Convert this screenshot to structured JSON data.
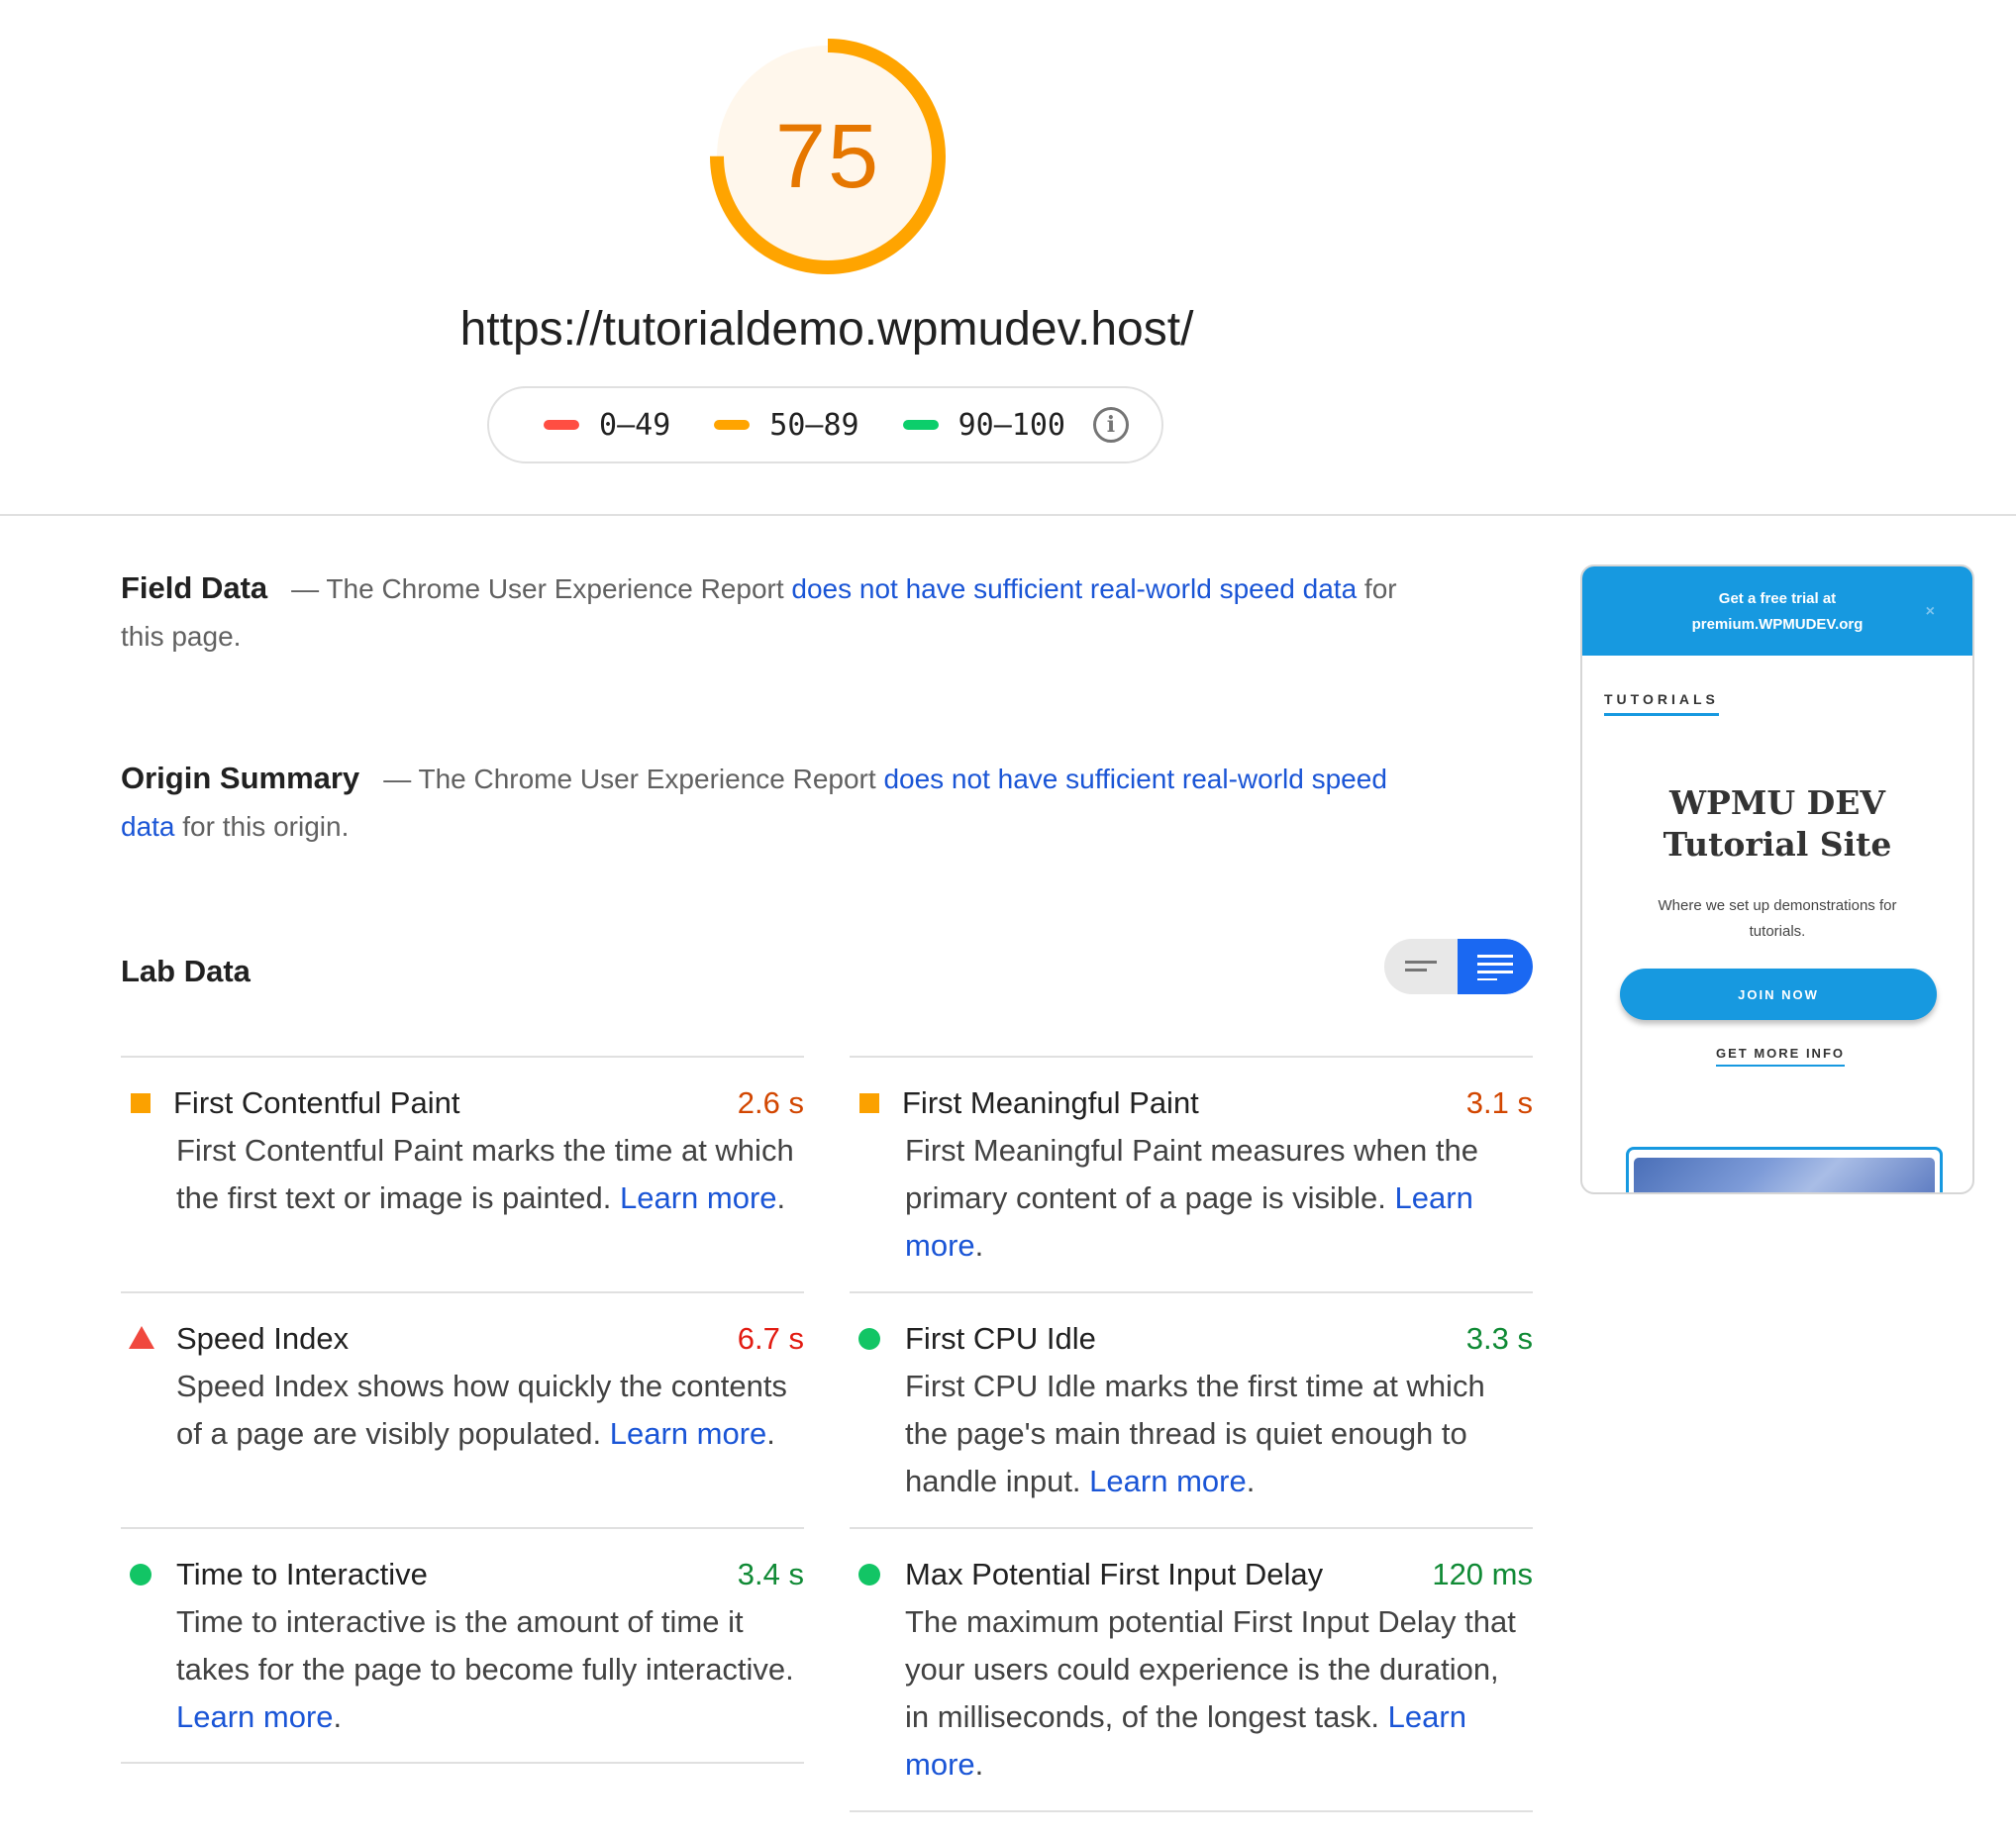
{
  "score": {
    "value": "75",
    "fraction": 0.75,
    "color": "#ffa400",
    "background": "#fff7ec"
  },
  "url": "https://tutorialdemo.wpmudev.host/",
  "legend": {
    "items": [
      {
        "label": "0–49",
        "color": "#ff4e42"
      },
      {
        "label": "50–89",
        "color": "#ffa400"
      },
      {
        "label": "90–100",
        "color": "#0cce6b"
      }
    ],
    "info_icon": "info-icon"
  },
  "field_data": {
    "heading": "Field Data",
    "prefix": "— The Chrome User Experience Report",
    "link": "does not have sufficient real-world speed data",
    "suffix": "for this page."
  },
  "origin_summary": {
    "heading": "Origin Summary",
    "prefix": "— The Chrome User Experience Report",
    "link": "does not have sufficient real-world speed data",
    "suffix": "for this origin."
  },
  "lab_data": {
    "heading": "Lab Data",
    "toggle": {
      "compact_icon": "compact-view-icon",
      "expanded_icon": "expanded-view-icon",
      "active": "expanded"
    },
    "metrics": [
      {
        "name": "First Contentful Paint",
        "value": "2.6 s",
        "status": "average",
        "description": "First Contentful Paint marks the time at which the first text or image is painted.",
        "link": "Learn more",
        "trail": "."
      },
      {
        "name": "First Meaningful Paint",
        "value": "3.1 s",
        "status": "average",
        "description": "First Meaningful Paint measures when the primary content of a page is visible.",
        "link": "Learn more",
        "trail": "."
      },
      {
        "name": "Speed Index",
        "value": "6.7 s",
        "status": "fail",
        "description": "Speed Index shows how quickly the contents of a page are visibly populated.",
        "link": "Learn more",
        "trail": "."
      },
      {
        "name": "First CPU Idle",
        "value": "3.3 s",
        "status": "pass",
        "description": "First CPU Idle marks the first time at which the page's main thread is quiet enough to handle input.",
        "link": "Learn more",
        "trail": "."
      },
      {
        "name": "Time to Interactive",
        "value": "3.4 s",
        "status": "pass",
        "description": "Time to interactive is the amount of time it takes for the page to become fully interactive.",
        "link": "Learn more",
        "trail": "."
      },
      {
        "name": "Max Potential First Input Delay",
        "value": "120 ms",
        "status": "pass",
        "description": "The maximum potential First Input Delay that your users could experience is the duration, in milliseconds, of the longest task.",
        "link": "Learn more",
        "trail": "."
      }
    ]
  },
  "screenshot": {
    "banner_line1": "Get a free trial at",
    "banner_line2": "premium.WPMUDEV.org",
    "close": "×",
    "nav": "TUTORIALS",
    "title_line1": "WPMU DEV",
    "title_line2": "Tutorial Site",
    "subtitle": "Where we set up demonstrations for tutorials.",
    "join_button": "JOIN NOW",
    "more_link": "GET MORE INFO"
  }
}
